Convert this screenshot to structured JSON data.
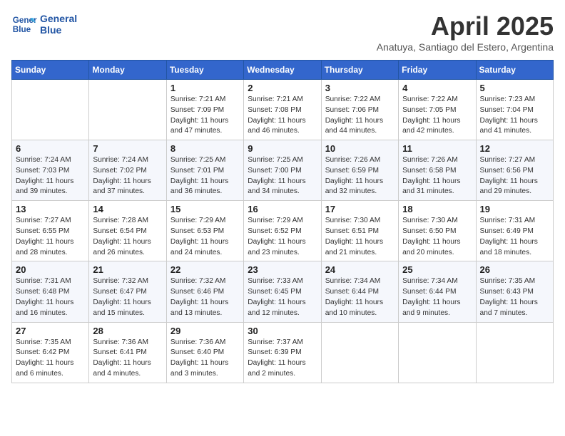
{
  "header": {
    "logo_line1": "General",
    "logo_line2": "Blue",
    "month_title": "April 2025",
    "subtitle": "Anatuya, Santiago del Estero, Argentina"
  },
  "weekdays": [
    "Sunday",
    "Monday",
    "Tuesday",
    "Wednesday",
    "Thursday",
    "Friday",
    "Saturday"
  ],
  "weeks": [
    [
      {
        "day": "",
        "sunrise": "",
        "sunset": "",
        "daylight": ""
      },
      {
        "day": "",
        "sunrise": "",
        "sunset": "",
        "daylight": ""
      },
      {
        "day": "1",
        "sunrise": "Sunrise: 7:21 AM",
        "sunset": "Sunset: 7:09 PM",
        "daylight": "Daylight: 11 hours and 47 minutes."
      },
      {
        "day": "2",
        "sunrise": "Sunrise: 7:21 AM",
        "sunset": "Sunset: 7:08 PM",
        "daylight": "Daylight: 11 hours and 46 minutes."
      },
      {
        "day": "3",
        "sunrise": "Sunrise: 7:22 AM",
        "sunset": "Sunset: 7:06 PM",
        "daylight": "Daylight: 11 hours and 44 minutes."
      },
      {
        "day": "4",
        "sunrise": "Sunrise: 7:22 AM",
        "sunset": "Sunset: 7:05 PM",
        "daylight": "Daylight: 11 hours and 42 minutes."
      },
      {
        "day": "5",
        "sunrise": "Sunrise: 7:23 AM",
        "sunset": "Sunset: 7:04 PM",
        "daylight": "Daylight: 11 hours and 41 minutes."
      }
    ],
    [
      {
        "day": "6",
        "sunrise": "Sunrise: 7:24 AM",
        "sunset": "Sunset: 7:03 PM",
        "daylight": "Daylight: 11 hours and 39 minutes."
      },
      {
        "day": "7",
        "sunrise": "Sunrise: 7:24 AM",
        "sunset": "Sunset: 7:02 PM",
        "daylight": "Daylight: 11 hours and 37 minutes."
      },
      {
        "day": "8",
        "sunrise": "Sunrise: 7:25 AM",
        "sunset": "Sunset: 7:01 PM",
        "daylight": "Daylight: 11 hours and 36 minutes."
      },
      {
        "day": "9",
        "sunrise": "Sunrise: 7:25 AM",
        "sunset": "Sunset: 7:00 PM",
        "daylight": "Daylight: 11 hours and 34 minutes."
      },
      {
        "day": "10",
        "sunrise": "Sunrise: 7:26 AM",
        "sunset": "Sunset: 6:59 PM",
        "daylight": "Daylight: 11 hours and 32 minutes."
      },
      {
        "day": "11",
        "sunrise": "Sunrise: 7:26 AM",
        "sunset": "Sunset: 6:58 PM",
        "daylight": "Daylight: 11 hours and 31 minutes."
      },
      {
        "day": "12",
        "sunrise": "Sunrise: 7:27 AM",
        "sunset": "Sunset: 6:56 PM",
        "daylight": "Daylight: 11 hours and 29 minutes."
      }
    ],
    [
      {
        "day": "13",
        "sunrise": "Sunrise: 7:27 AM",
        "sunset": "Sunset: 6:55 PM",
        "daylight": "Daylight: 11 hours and 28 minutes."
      },
      {
        "day": "14",
        "sunrise": "Sunrise: 7:28 AM",
        "sunset": "Sunset: 6:54 PM",
        "daylight": "Daylight: 11 hours and 26 minutes."
      },
      {
        "day": "15",
        "sunrise": "Sunrise: 7:29 AM",
        "sunset": "Sunset: 6:53 PM",
        "daylight": "Daylight: 11 hours and 24 minutes."
      },
      {
        "day": "16",
        "sunrise": "Sunrise: 7:29 AM",
        "sunset": "Sunset: 6:52 PM",
        "daylight": "Daylight: 11 hours and 23 minutes."
      },
      {
        "day": "17",
        "sunrise": "Sunrise: 7:30 AM",
        "sunset": "Sunset: 6:51 PM",
        "daylight": "Daylight: 11 hours and 21 minutes."
      },
      {
        "day": "18",
        "sunrise": "Sunrise: 7:30 AM",
        "sunset": "Sunset: 6:50 PM",
        "daylight": "Daylight: 11 hours and 20 minutes."
      },
      {
        "day": "19",
        "sunrise": "Sunrise: 7:31 AM",
        "sunset": "Sunset: 6:49 PM",
        "daylight": "Daylight: 11 hours and 18 minutes."
      }
    ],
    [
      {
        "day": "20",
        "sunrise": "Sunrise: 7:31 AM",
        "sunset": "Sunset: 6:48 PM",
        "daylight": "Daylight: 11 hours and 16 minutes."
      },
      {
        "day": "21",
        "sunrise": "Sunrise: 7:32 AM",
        "sunset": "Sunset: 6:47 PM",
        "daylight": "Daylight: 11 hours and 15 minutes."
      },
      {
        "day": "22",
        "sunrise": "Sunrise: 7:32 AM",
        "sunset": "Sunset: 6:46 PM",
        "daylight": "Daylight: 11 hours and 13 minutes."
      },
      {
        "day": "23",
        "sunrise": "Sunrise: 7:33 AM",
        "sunset": "Sunset: 6:45 PM",
        "daylight": "Daylight: 11 hours and 12 minutes."
      },
      {
        "day": "24",
        "sunrise": "Sunrise: 7:34 AM",
        "sunset": "Sunset: 6:44 PM",
        "daylight": "Daylight: 11 hours and 10 minutes."
      },
      {
        "day": "25",
        "sunrise": "Sunrise: 7:34 AM",
        "sunset": "Sunset: 6:44 PM",
        "daylight": "Daylight: 11 hours and 9 minutes."
      },
      {
        "day": "26",
        "sunrise": "Sunrise: 7:35 AM",
        "sunset": "Sunset: 6:43 PM",
        "daylight": "Daylight: 11 hours and 7 minutes."
      }
    ],
    [
      {
        "day": "27",
        "sunrise": "Sunrise: 7:35 AM",
        "sunset": "Sunset: 6:42 PM",
        "daylight": "Daylight: 11 hours and 6 minutes."
      },
      {
        "day": "28",
        "sunrise": "Sunrise: 7:36 AM",
        "sunset": "Sunset: 6:41 PM",
        "daylight": "Daylight: 11 hours and 4 minutes."
      },
      {
        "day": "29",
        "sunrise": "Sunrise: 7:36 AM",
        "sunset": "Sunset: 6:40 PM",
        "daylight": "Daylight: 11 hours and 3 minutes."
      },
      {
        "day": "30",
        "sunrise": "Sunrise: 7:37 AM",
        "sunset": "Sunset: 6:39 PM",
        "daylight": "Daylight: 11 hours and 2 minutes."
      },
      {
        "day": "",
        "sunrise": "",
        "sunset": "",
        "daylight": ""
      },
      {
        "day": "",
        "sunrise": "",
        "sunset": "",
        "daylight": ""
      },
      {
        "day": "",
        "sunrise": "",
        "sunset": "",
        "daylight": ""
      }
    ]
  ]
}
